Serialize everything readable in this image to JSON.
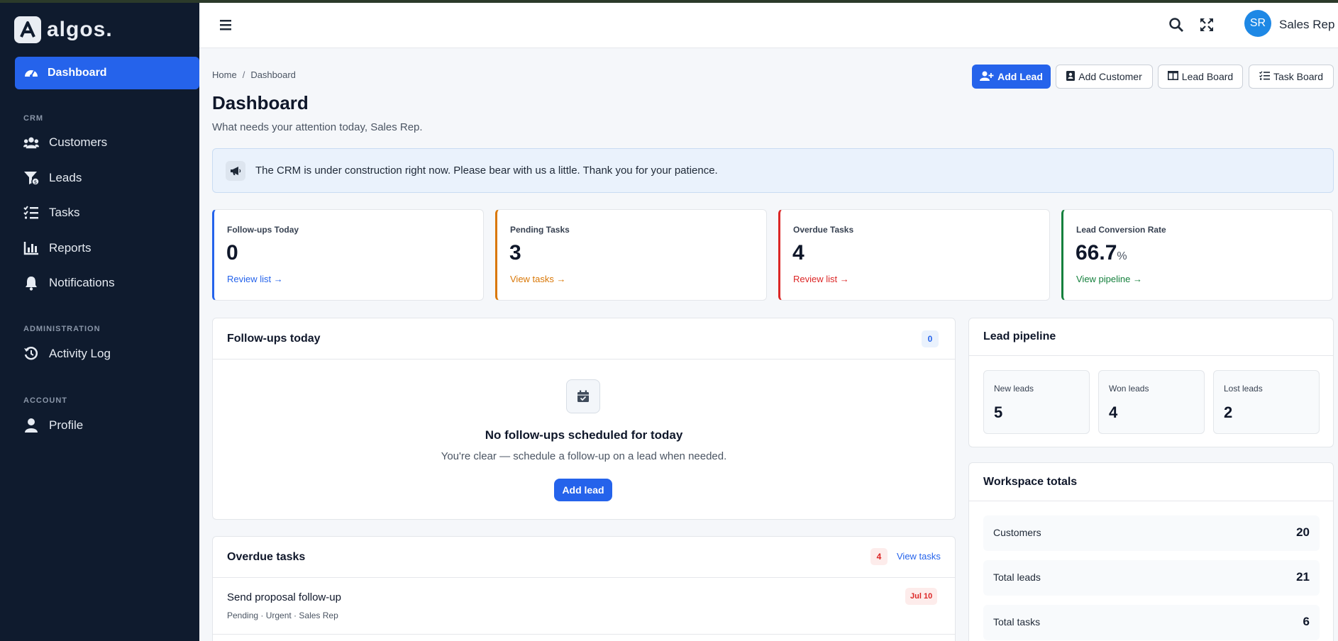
{
  "brand": {
    "name": "algos."
  },
  "sidebar": {
    "active": {
      "label": "Dashboard"
    },
    "sections": [
      {
        "title": "CRM",
        "items": [
          {
            "label": "Customers",
            "icon": "users-icon"
          },
          {
            "label": "Leads",
            "icon": "funnel-dollar-icon"
          },
          {
            "label": "Tasks",
            "icon": "task-list-icon"
          },
          {
            "label": "Reports",
            "icon": "bar-chart-icon"
          },
          {
            "label": "Notifications",
            "icon": "bell-icon"
          }
        ]
      },
      {
        "title": "ADMINISTRATION",
        "items": [
          {
            "label": "Activity Log",
            "icon": "history-icon"
          }
        ]
      },
      {
        "title": "ACCOUNT",
        "items": [
          {
            "label": "Profile",
            "icon": "user-icon"
          }
        ]
      }
    ]
  },
  "topbar": {
    "avatar_initials": "SR",
    "user_name": "Sales Rep"
  },
  "breadcrumb": {
    "home": "Home",
    "separator": "/",
    "current": "Dashboard"
  },
  "page": {
    "title": "Dashboard",
    "subtitle": "What needs your attention today, Sales Rep."
  },
  "actions": {
    "add_lead": "Add Lead",
    "add_customer": "Add Customer",
    "lead_board": "Lead Board",
    "task_board": "Task Board"
  },
  "notice": {
    "text": "The CRM is under construction right now. Please bear with us a little. Thank you for your patience."
  },
  "stats": [
    {
      "label": "Follow-ups Today",
      "value": "0",
      "unit": "",
      "link": "Review list →",
      "color": "#2563eb"
    },
    {
      "label": "Pending Tasks",
      "value": "3",
      "unit": "",
      "link": "View tasks →",
      "color": "#d97706"
    },
    {
      "label": "Overdue Tasks",
      "value": "4",
      "unit": "",
      "link": "Review list →",
      "color": "#dc2626"
    },
    {
      "label": "Lead Conversion Rate",
      "value": "66.7",
      "unit": "%",
      "link": "View pipeline →",
      "color": "#15803d"
    }
  ],
  "followups": {
    "title": "Follow-ups today",
    "count": "0",
    "empty_title": "No follow-ups scheduled for today",
    "empty_desc": "You're clear — schedule a follow-up on a lead when needed.",
    "button": "Add lead"
  },
  "overdue": {
    "title": "Overdue tasks",
    "count": "4",
    "link": "View tasks",
    "items": [
      {
        "title": "Send proposal follow-up",
        "meta": "Pending · Urgent · Sales Rep",
        "date": "Jul 10"
      }
    ]
  },
  "pipeline": {
    "title": "Lead pipeline",
    "items": [
      {
        "label": "New leads",
        "value": "5"
      },
      {
        "label": "Won leads",
        "value": "4"
      },
      {
        "label": "Lost leads",
        "value": "2"
      }
    ]
  },
  "totals": {
    "title": "Workspace totals",
    "items": [
      {
        "label": "Customers",
        "value": "20"
      },
      {
        "label": "Total leads",
        "value": "21"
      },
      {
        "label": "Total tasks",
        "value": "6"
      }
    ]
  },
  "colors": {
    "accent": "#2563eb",
    "sidebar_bg": "#0f1b2e",
    "page_bg": "#f5f7fa"
  }
}
